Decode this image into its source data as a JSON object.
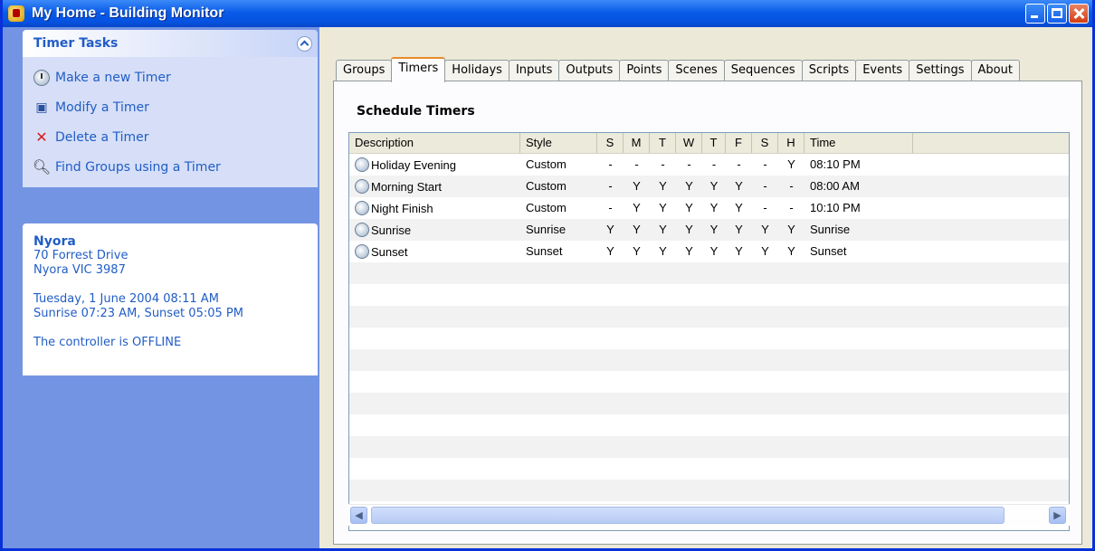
{
  "window": {
    "title": "My Home - Building Monitor"
  },
  "tasks": {
    "header": "Timer Tasks",
    "items": [
      {
        "label": "Make a new Timer",
        "icon": "clock-icon"
      },
      {
        "label": "Modify a Timer",
        "icon": "monitor-icon"
      },
      {
        "label": "Delete a Timer",
        "icon": "delete-x-icon"
      },
      {
        "label": "Find Groups using a Timer",
        "icon": "magnifier-icon"
      }
    ]
  },
  "info": {
    "name": "Nyora",
    "address1": "70 Forrest Drive",
    "address2": "Nyora VIC 3987",
    "datetime": "Tuesday, 1 June 2004 08:11 AM",
    "sun": "Sunrise 07:23 AM, Sunset 05:05 PM",
    "status": "The controller is OFFLINE"
  },
  "tabs": [
    "Groups",
    "Timers",
    "Holidays",
    "Inputs",
    "Outputs",
    "Points",
    "Scenes",
    "Sequences",
    "Scripts",
    "Events",
    "Settings",
    "About"
  ],
  "active_tab": "Timers",
  "panel_title": "Schedule Timers",
  "columns": [
    "Description",
    "Style",
    "S",
    "M",
    "T",
    "W",
    "T",
    "F",
    "S",
    "H",
    "Time"
  ],
  "rows": [
    [
      "Holiday Evening",
      "Custom",
      "-",
      "-",
      "-",
      "-",
      "-",
      "-",
      "-",
      "Y",
      "08:10 PM"
    ],
    [
      "Morning Start",
      "Custom",
      "-",
      "Y",
      "Y",
      "Y",
      "Y",
      "Y",
      "-",
      "-",
      "08:00 AM"
    ],
    [
      "Night Finish",
      "Custom",
      "-",
      "Y",
      "Y",
      "Y",
      "Y",
      "Y",
      "-",
      "-",
      "10:10 PM"
    ],
    [
      "Sunrise",
      "Sunrise",
      "Y",
      "Y",
      "Y",
      "Y",
      "Y",
      "Y",
      "Y",
      "Y",
      "Sunrise"
    ],
    [
      "Sunset",
      "Sunset",
      "Y",
      "Y",
      "Y",
      "Y",
      "Y",
      "Y",
      "Y",
      "Y",
      "Sunset"
    ]
  ]
}
